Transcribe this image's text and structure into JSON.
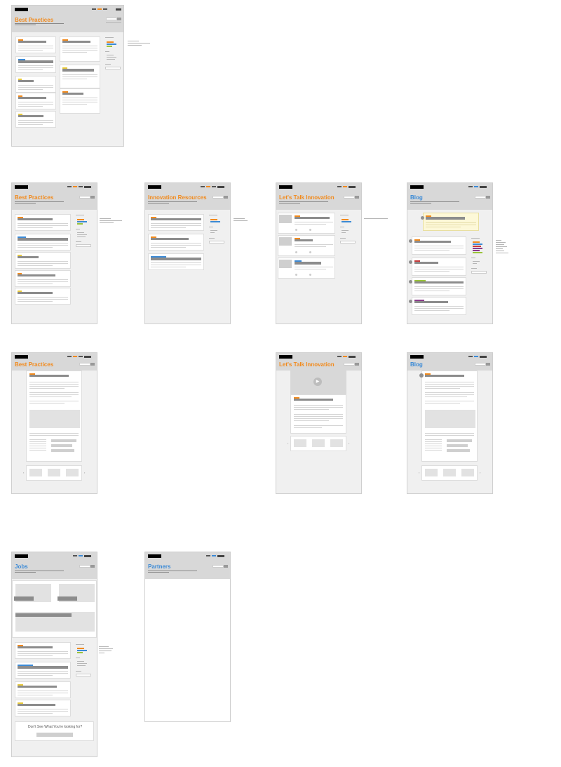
{
  "frames": {
    "best_practices_1": {
      "title": "Best Practices"
    },
    "best_practices_2": {
      "title": "Best Practices"
    },
    "innovation_resources": {
      "title": "Innovation Resources"
    },
    "lets_talk_1": {
      "title": "Let's Talk Innovation"
    },
    "blog_1": {
      "title": "Blog"
    },
    "best_practices_3": {
      "title": "Best Practices"
    },
    "lets_talk_2": {
      "title": "Let's Talk Innovation"
    },
    "blog_2": {
      "title": "Blog"
    },
    "jobs": {
      "title": "Jobs",
      "cta": "Don't See What You're looking for?"
    },
    "partners": {
      "title": "Partners"
    }
  },
  "colors": {
    "orange": "#f28a1c",
    "blue": "#3b8ad6",
    "yellow": "#e8c93a",
    "green": "#9ac43a",
    "purple": "#8a3a8a",
    "red": "#c83a3a"
  }
}
